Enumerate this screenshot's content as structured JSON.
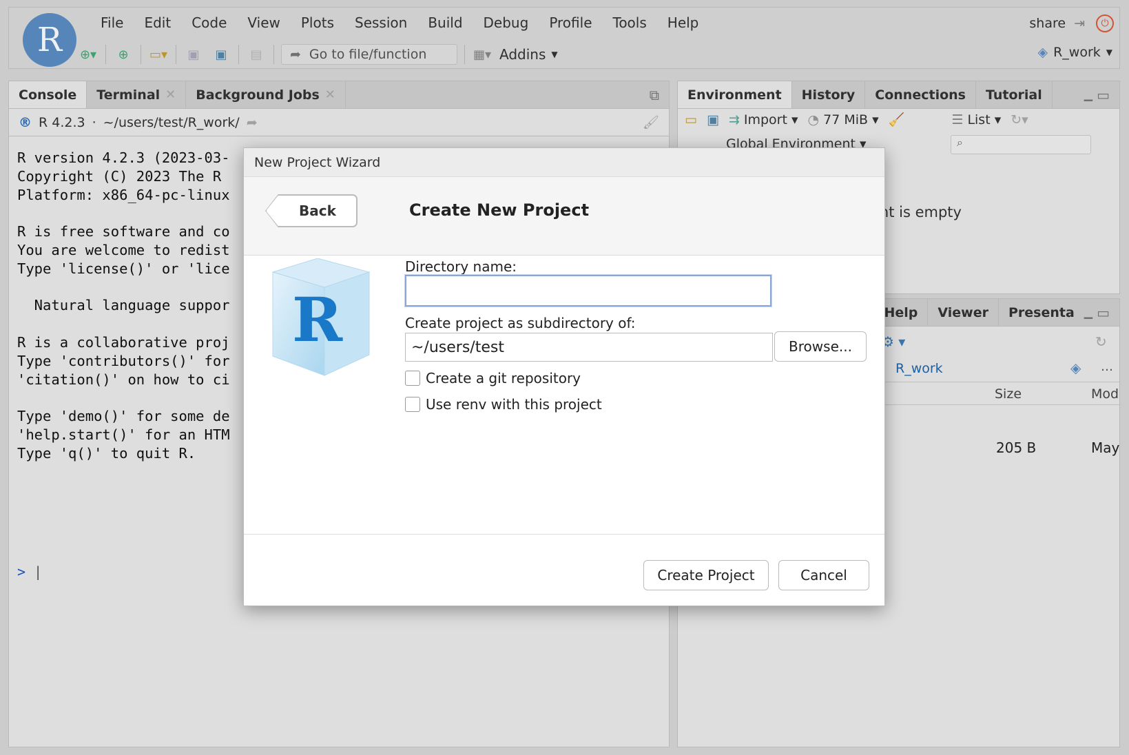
{
  "app": {
    "logo_letter": "R"
  },
  "menu": [
    "File",
    "Edit",
    "Code",
    "View",
    "Plots",
    "Session",
    "Build",
    "Debug",
    "Profile",
    "Tools",
    "Help"
  ],
  "toolbar": {
    "goto_placeholder": "Go to file/function",
    "addins_label": "Addins"
  },
  "header": {
    "share_label": "share",
    "project_label": "R_work"
  },
  "console_pane": {
    "tabs": [
      {
        "label": "Console"
      },
      {
        "label": "Terminal"
      },
      {
        "label": "Background Jobs"
      }
    ],
    "version_label": "R 4.2.3",
    "path": "~/users/test/R_work/",
    "output": "R version 4.2.3 (2023-03-\nCopyright (C) 2023 The R \nPlatform: x86_64-pc-linux\n\nR is free software and co\nYou are welcome to redist\nType 'license()' or 'lice\n\n  Natural language suppor\n\nR is a collaborative proj\nType 'contributors()' for\n'citation()' on how to ci\n\nType 'demo()' for some de\n'help.start()' for an HTM\nType 'q()' to quit R.",
    "prompt": ">"
  },
  "env_pane": {
    "tabs": [
      {
        "label": "Environment"
      },
      {
        "label": "History"
      },
      {
        "label": "Connections"
      },
      {
        "label": "Tutorial"
      }
    ],
    "import_label": "Import",
    "memory_label": "77 MiB",
    "view_label": "List",
    "scope_label": "Global Environment",
    "empty_text": "ent is empty"
  },
  "files_pane": {
    "tabs": [
      {
        "label": "Help"
      },
      {
        "label": "Viewer"
      },
      {
        "label": "Presenta"
      }
    ],
    "breadcrumb": "R_work",
    "columns": {
      "size": "Size",
      "modified": "Mod"
    },
    "row": {
      "size": "205 B",
      "modified": "May"
    }
  },
  "dialog": {
    "title": "New Project Wizard",
    "back_label": "Back",
    "heading": "Create New Project",
    "directory_label": "Directory name:",
    "directory_value": "",
    "parent_label": "Create project as subdirectory of:",
    "parent_value": "~/users/test",
    "browse_label": "Browse...",
    "git_label": "Create a git repository",
    "renv_label": "Use renv with this project",
    "create_label": "Create Project",
    "cancel_label": "Cancel"
  },
  "colors": {
    "accent": "#5b8ec5",
    "link": "#2266aa",
    "focus": "#8aa6d6"
  }
}
